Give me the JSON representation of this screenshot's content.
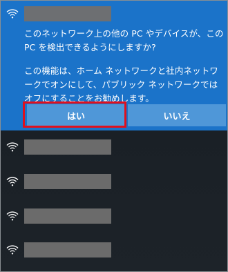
{
  "expanded_network": {
    "icon": "wifi-icon",
    "name_masked": "",
    "question": "このネットワーク上の他の PC やデバイスが、この PC を検出できるようにしますか?",
    "info": "この機能は、ホーム ネットワークと社内ネットワークでオンにして、パブリック ネットワークではオフにすることをお勧めします。",
    "yes_label": "はい",
    "no_label": "いいえ",
    "highlighted_button": "yes"
  },
  "other_networks": [
    {
      "icon": "wifi-icon",
      "name_masked": ""
    },
    {
      "icon": "wifi-icon",
      "name_masked": ""
    },
    {
      "icon": "wifi-icon",
      "name_masked": ""
    },
    {
      "icon": "wifi-icon",
      "name_masked": ""
    }
  ],
  "colors": {
    "panel_blue": "#1b73c9",
    "button_blue": "#4f97d8",
    "highlight_red": "#e0101e",
    "background_dark": "#1b2127",
    "mask_gray": "#6e6e6e"
  }
}
